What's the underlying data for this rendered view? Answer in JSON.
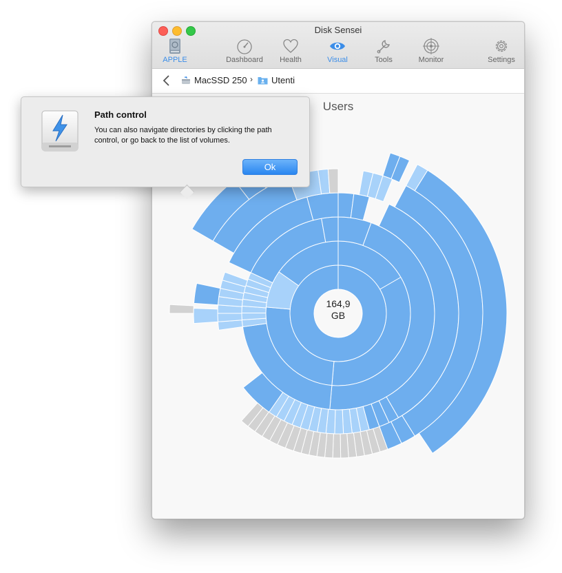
{
  "window": {
    "title": "Disk Sensei"
  },
  "toolbar": {
    "volume_label": "APPLE",
    "items": [
      {
        "label": "Dashboard",
        "icon": "speedometer-icon"
      },
      {
        "label": "Health",
        "icon": "heart-icon"
      },
      {
        "label": "Visual",
        "icon": "eye-icon",
        "active": true
      },
      {
        "label": "Tools",
        "icon": "wrench-icon"
      },
      {
        "label": "Monitor",
        "icon": "monitor-target-icon"
      },
      {
        "label": "Settings",
        "icon": "gear-icon"
      }
    ],
    "accent": "#3b8de8"
  },
  "pathbar": {
    "segments": [
      "MacSSD 250",
      "Utenti"
    ],
    "separator": "›"
  },
  "main": {
    "title": "Users",
    "center_value": "164,9",
    "center_unit": "GB",
    "colors": {
      "folder": "#6eaeee",
      "file": "#a8d2fa",
      "other": "#d2d2d2"
    }
  },
  "popover": {
    "title": "Path control",
    "body": "You can also navigate directories by clicking the path control, or go back to the list of volumes.",
    "ok_label": "Ok"
  }
}
